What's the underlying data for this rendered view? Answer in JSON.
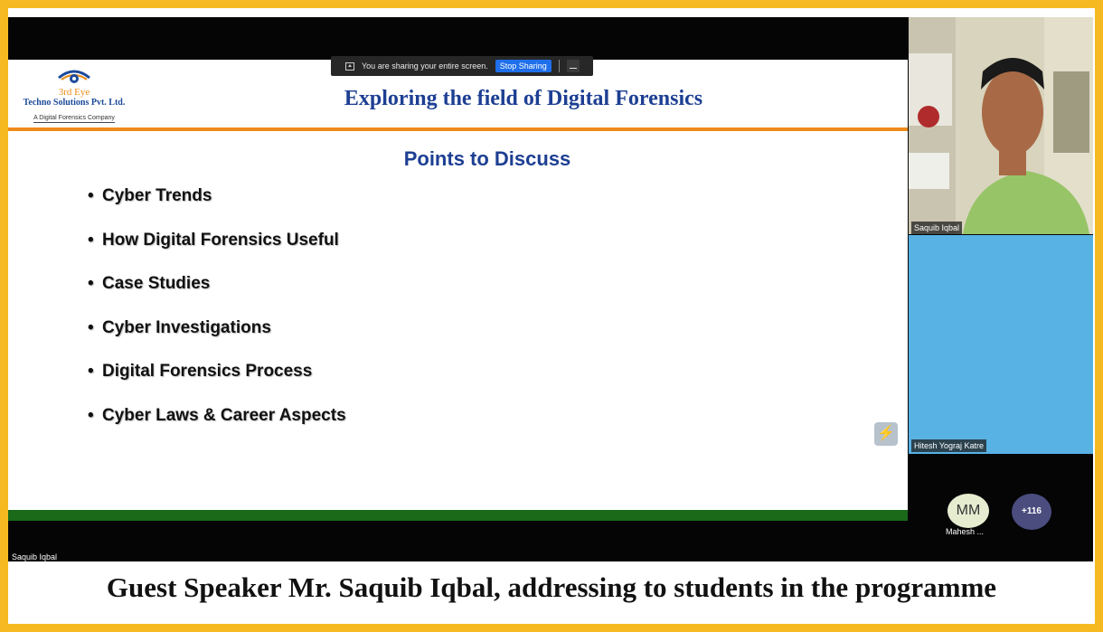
{
  "logo": {
    "line1": "3rd Eye",
    "line2": "Techno Solutions Pvt. Ltd.",
    "line3": "A Digital Forensics Company"
  },
  "slide": {
    "title": "Exploring the field of Digital Forensics",
    "subtitle": "Points to Discuss",
    "points": [
      "Cyber Trends",
      "How Digital Forensics Useful",
      "Case Studies",
      "Cyber Investigations",
      "Digital Forensics Process",
      "Cyber Laws & Career Aspects"
    ],
    "bullet_char": "•",
    "icon_glyph": "⚡"
  },
  "share_bar": {
    "message": "You are sharing your entire screen.",
    "stop_label": "Stop Sharing"
  },
  "participants": {
    "video1_name": "Saquib Iqbal",
    "video2_name": "Hitesh Yograj Katre",
    "mm_initials": "MM",
    "mm_name": "Mahesh ...",
    "more_count": "+116"
  },
  "speaker_label": "Saquib Iqbal",
  "caption": "Guest Speaker Mr. Saquib Iqbal,  addressing to students in the programme",
  "colors": {
    "frame": "#f6b921",
    "title_blue": "#1d3f93",
    "orange_line": "#ee8b1c",
    "green_line": "#1a6a1a",
    "stop_button": "#1f6feb",
    "video2_bg": "#58b2e4"
  }
}
